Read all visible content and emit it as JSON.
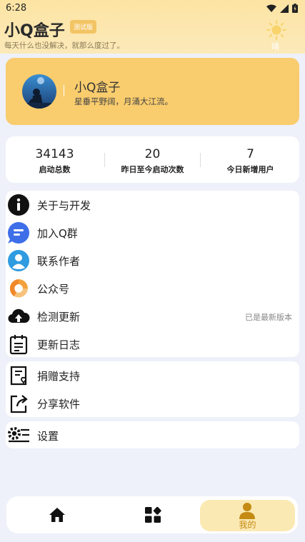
{
  "status_bar": {
    "time": "6:28"
  },
  "header": {
    "title": "小Q盒子",
    "badge": "测试版",
    "subtitle": "每天什么也没解决，就那么度过了。",
    "weather": "晴"
  },
  "profile": {
    "name": "小Q盒子",
    "quote": "星垂平野阔，月涌大江流。"
  },
  "stats": [
    {
      "value": "34143",
      "label": "启动总数"
    },
    {
      "value": "20",
      "label": "昨日至今启动次数"
    },
    {
      "value": "7",
      "label": "今日新增用户"
    }
  ],
  "menu": {
    "about": "关于与开发",
    "join_group": "加入Q群",
    "contact": "联系作者",
    "official": "公众号",
    "check_update": "检测更新",
    "update_status": "已是最新版本",
    "changelog": "更新日志",
    "donate": "捐赠支持",
    "share": "分享软件",
    "settings": "设置"
  },
  "bottom_nav": {
    "mine": "我的"
  },
  "colors": {
    "accent": "#f9cc6d",
    "nav_active_bg": "#fbe9b3",
    "nav_active_text": "#c48a12",
    "background": "#eef1f9"
  }
}
